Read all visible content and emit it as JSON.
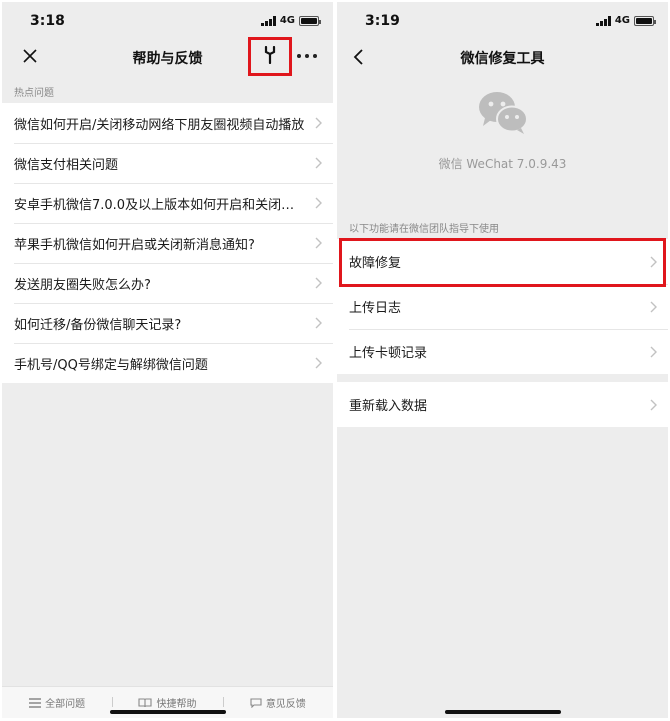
{
  "left": {
    "status": {
      "time": "3:18",
      "network": "4G"
    },
    "nav": {
      "title": "帮助与反馈"
    },
    "section_label": "热点问题",
    "items": [
      {
        "label": "微信如何开启/关闭移动网络下朋友圈视频自动播放"
      },
      {
        "label": "微信支付相关问题"
      },
      {
        "label": "安卓手机微信7.0.0及以上版本如何开启和关闭微…"
      },
      {
        "label": "苹果手机微信如何开启或关闭新消息通知?"
      },
      {
        "label": "发送朋友圈失败怎么办?"
      },
      {
        "label": "如何迁移/备份微信聊天记录?"
      },
      {
        "label": "手机号/QQ号绑定与解绑微信问题"
      }
    ],
    "tabs": [
      {
        "label": "全部问题",
        "icon": "list-icon"
      },
      {
        "label": "快捷帮助",
        "icon": "book-icon"
      },
      {
        "label": "意见反馈",
        "icon": "chat-icon"
      }
    ]
  },
  "right": {
    "status": {
      "time": "3:19",
      "network": "4G"
    },
    "nav": {
      "title": "微信修复工具"
    },
    "version": "微信 WeChat 7.0.9.43",
    "section_label": "以下功能请在微信团队指导下使用",
    "items": [
      {
        "label": "故障修复"
      },
      {
        "label": "上传日志"
      },
      {
        "label": "上传卡顿记录"
      }
    ],
    "items2": [
      {
        "label": "重新载入数据"
      }
    ]
  },
  "colors": {
    "highlight": "#e0161c",
    "background": "#ededed",
    "accent_gray": "#b7b7b7"
  }
}
